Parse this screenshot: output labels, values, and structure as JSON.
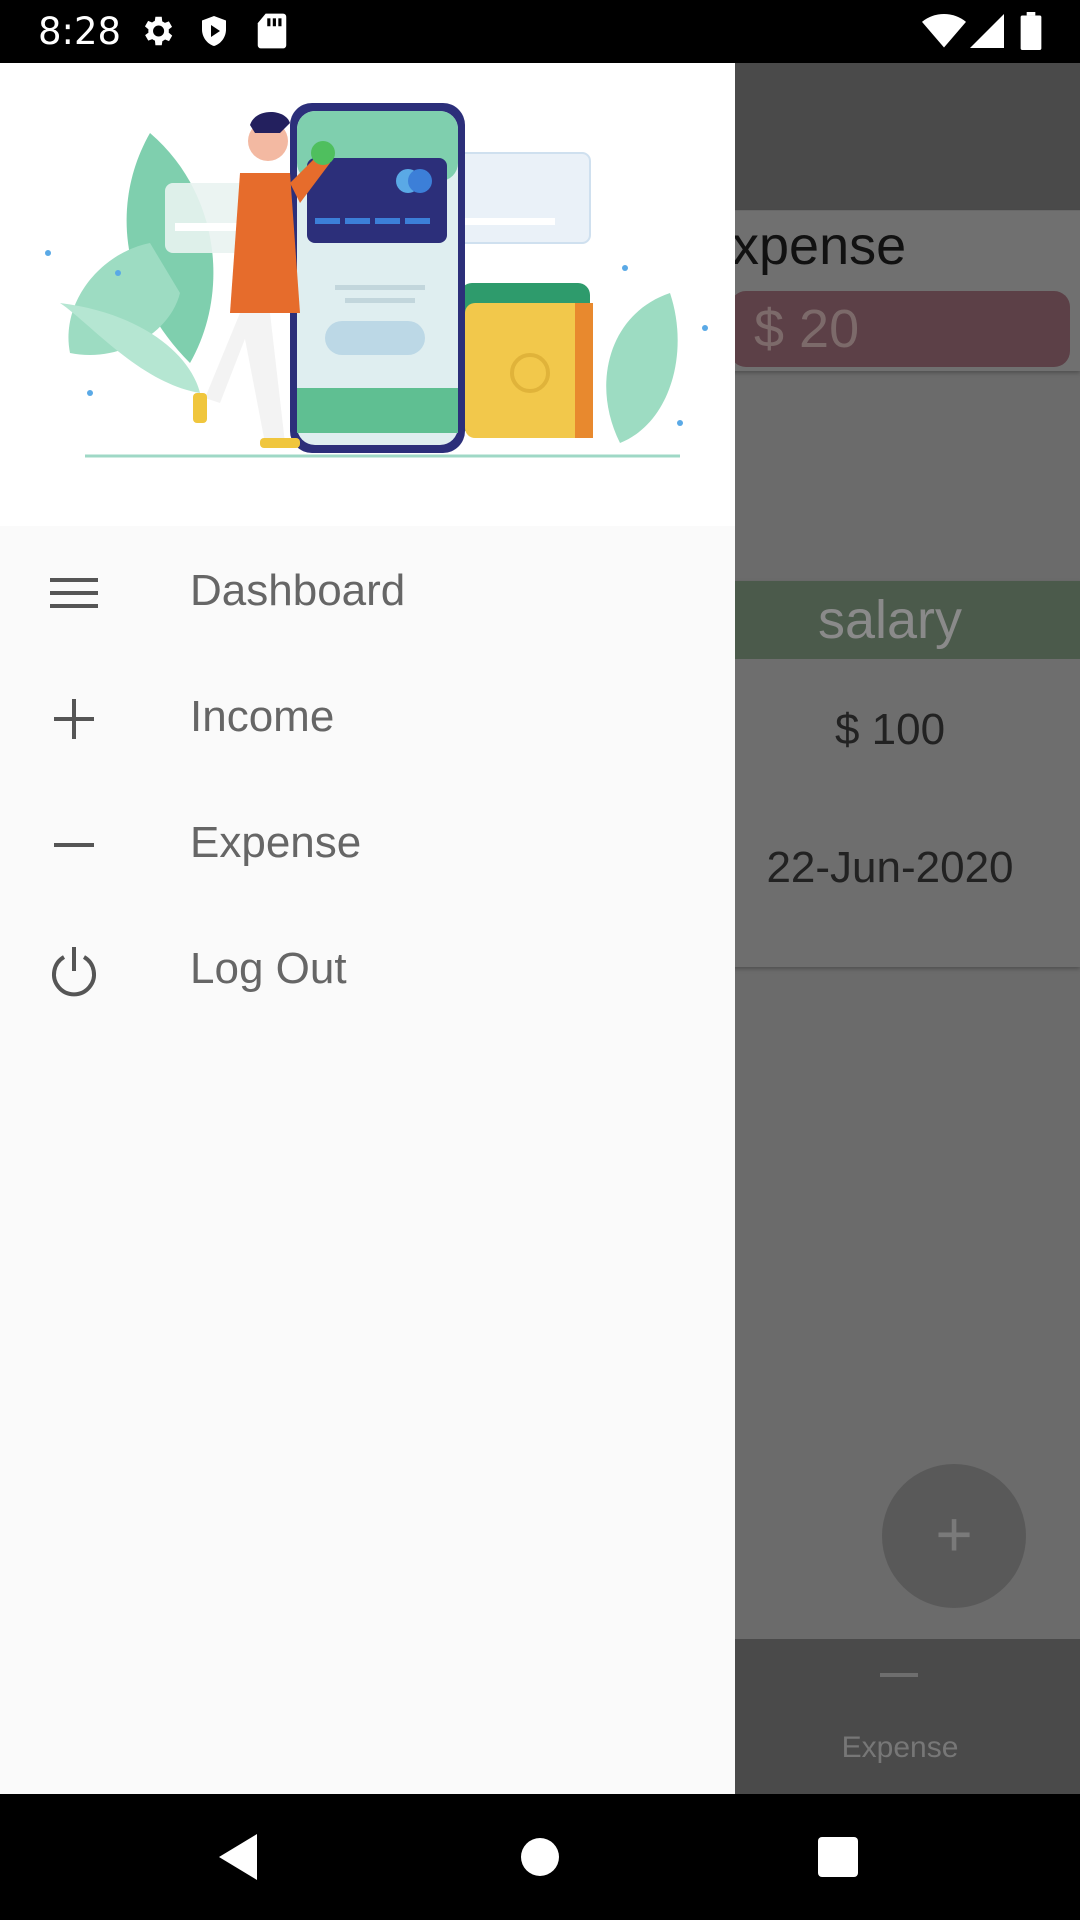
{
  "status_bar": {
    "time": "8:28"
  },
  "background_screen": {
    "card1": {
      "title": "xpense",
      "amount": "$ 20"
    },
    "card2": {
      "title": "salary",
      "amount": "$ 100",
      "date": "22-Jun-2020"
    },
    "fab_symbol": "+",
    "bottom_nav": {
      "label": "Expense"
    }
  },
  "drawer": {
    "menu": [
      {
        "label": "Dashboard",
        "icon": "menu-icon"
      },
      {
        "label": "Income",
        "icon": "plus-icon"
      },
      {
        "label": "Expense",
        "icon": "minus-icon"
      },
      {
        "label": "Log Out",
        "icon": "power-icon"
      }
    ]
  },
  "colors": {
    "drawer_bg": "#fafafa",
    "scrim_card_expense": "#5c4047",
    "scrim_card_salary": "#4b5a4b"
  }
}
